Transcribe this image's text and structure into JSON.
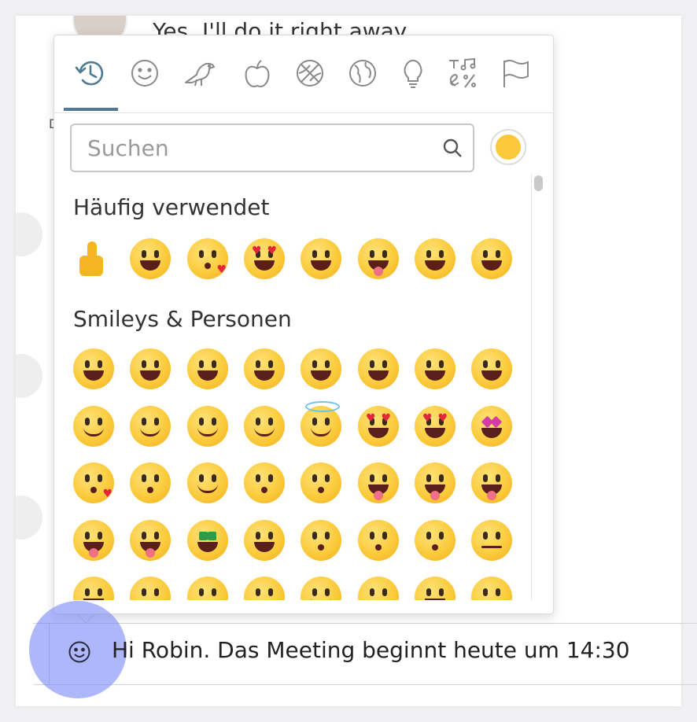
{
  "chat": {
    "previous_message": "Yes, I'll do it right away",
    "composer_text": "Hi Robin. Das Meeting beginnt heute um 14:30"
  },
  "picker": {
    "categories": [
      {
        "name": "recent",
        "icon": "clock-history-icon",
        "active": true
      },
      {
        "name": "smileys",
        "icon": "smiley-icon",
        "active": false
      },
      {
        "name": "animals",
        "icon": "bird-icon",
        "active": false
      },
      {
        "name": "food",
        "icon": "apple-icon",
        "active": false
      },
      {
        "name": "activities",
        "icon": "basketball-icon",
        "active": false
      },
      {
        "name": "travel",
        "icon": "globe-icon",
        "active": false
      },
      {
        "name": "objects",
        "icon": "lightbulb-icon",
        "active": false
      },
      {
        "name": "symbols",
        "icon": "symbols-icon",
        "active": false
      },
      {
        "name": "flags",
        "icon": "flag-icon",
        "active": false
      }
    ],
    "search_placeholder": "Suchen",
    "skin_tone_color": "#fbc93b",
    "accent_color": "#4f7a8f",
    "sections": [
      {
        "title": "Häufig verwendet",
        "emojis": [
          "👍",
          "😀",
          "😘",
          "😍",
          "😆",
          "😜",
          "😅",
          "😂"
        ]
      },
      {
        "title": "Smileys & Personen",
        "emojis": [
          "😀",
          "😃",
          "😄",
          "😁",
          "😆",
          "😅",
          "🤣",
          "😂",
          "🙂",
          "🙃",
          "😉",
          "😊",
          "😇",
          "🥰",
          "😍",
          "🤩",
          "😘",
          "😗",
          "☺️",
          "😚",
          "😙",
          "😋",
          "😛",
          "😜",
          "🤪",
          "😝",
          "🤑",
          "🤗",
          "🤭",
          "🤫",
          "🤔",
          "🤐",
          "🤨",
          "😐",
          "😑",
          "😶",
          "😏",
          "😒",
          "🙄",
          "😬"
        ]
      }
    ]
  }
}
